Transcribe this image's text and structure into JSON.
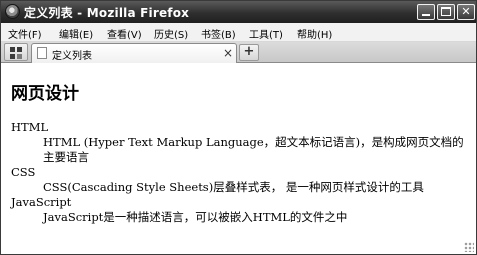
{
  "window": {
    "title": "定义列表 - Mozilla Firefox",
    "minimize_label": "",
    "maximize_label": "",
    "close_label": "✕"
  },
  "menubar": {
    "items": [
      {
        "label": "文件(F)"
      },
      {
        "label": "编辑(E)"
      },
      {
        "label": "查看(V)"
      },
      {
        "label": "历史(S)"
      },
      {
        "label": "书签(B)"
      },
      {
        "label": "工具(T)"
      },
      {
        "label": "帮助(H)"
      }
    ]
  },
  "tabs": {
    "active": {
      "title": "定义列表",
      "close_glyph": "×"
    },
    "new_tab_glyph": "+"
  },
  "content": {
    "heading": "网页设计",
    "definitions": [
      {
        "term": "HTML",
        "description": "HTML (Hyper Text Markup Language，超文本标记语言)，是构成网页文档的主要语言"
      },
      {
        "term": "CSS",
        "description": "CSS(Cascading Style Sheets)层叠样式表， 是一种网页样式设计的工具"
      },
      {
        "term": "JavaScript",
        "description": "JavaScript是一种描述语言，可以被嵌入HTML的文件之中"
      }
    ]
  },
  "colors": {
    "titlebar": "#2f2f2f",
    "menubar": "#f2f2f2",
    "tabbar": "#d0d0d0",
    "content": "#ffffff"
  }
}
